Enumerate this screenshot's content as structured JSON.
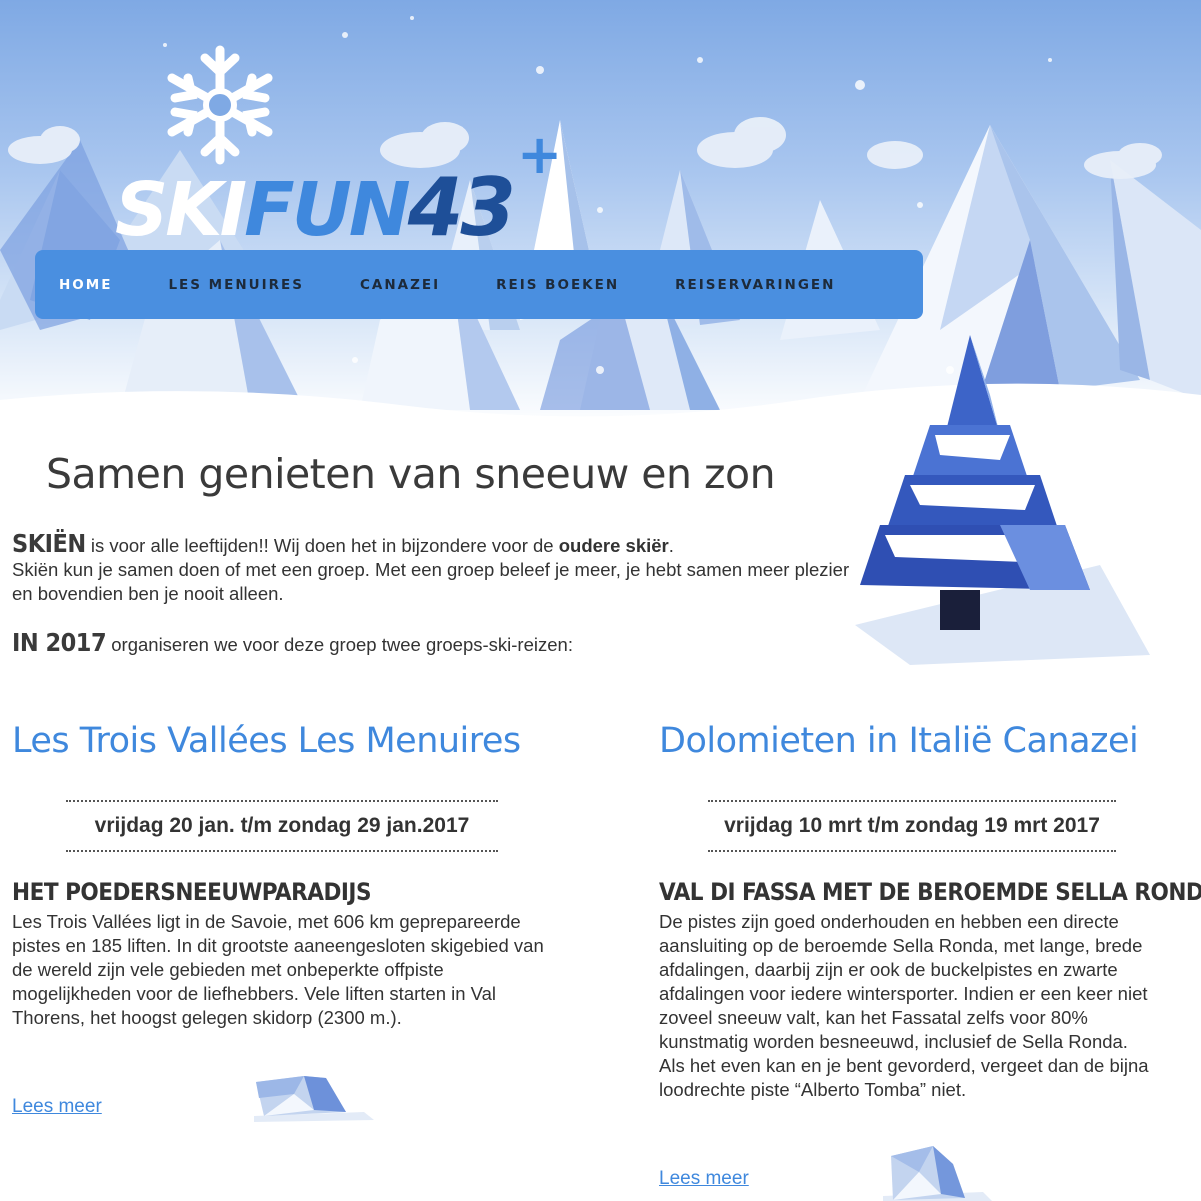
{
  "brand": {
    "logo_ski": "SKI",
    "logo_fun": "FUN",
    "logo_number": "43",
    "logo_plus": "+"
  },
  "nav": {
    "items": [
      {
        "label": "HOME",
        "active": true
      },
      {
        "label": "LES MENUIRES",
        "active": false
      },
      {
        "label": "CANAZEI",
        "active": false
      },
      {
        "label": "REIS BOEKEN",
        "active": false
      },
      {
        "label": "REISERVARINGEN",
        "active": false
      }
    ]
  },
  "intro": {
    "title": "Samen genieten van sneeuw en zon",
    "lead_word": "SKIËN",
    "lead_rest_1": " is voor alle leeftijden!! Wij doen het in bijzondere voor de ",
    "lead_bold": "oudere skiër",
    "lead_rest_2": ".",
    "paragraph": "Skiën kun je samen doen of met een groep. Met een groep beleef je meer, je hebt samen meer plezier en bovendien ben je nooit alleen.",
    "year_word": "IN 2017",
    "year_rest": " organiseren we voor deze groep twee groeps-ski-reizen:"
  },
  "trips": [
    {
      "title": "Les Trois Vallées Les Menuires",
      "dates": "vrijdag 20 jan. t/m zondag 29 jan.2017",
      "heading": "HET POEDERSNEEUWPARADIJS",
      "text": "Les Trois Vallées ligt in de Savoie, met 606 km geprepareerde pistes en 185 liften. In dit grootste aaneengesloten skigebied van de wereld zijn vele gebieden met onbeperkte offpiste mogelijkheden voor de liefhebbers. Vele liften starten in Val Thorens, het hoogst gelegen skidorp (2300 m.).",
      "link": "Lees meer"
    },
    {
      "title": "Dolomieten in Italië Canazei",
      "dates": "vrijdag 10 mrt t/m zondag 19 mrt 2017",
      "heading": "VAL DI FASSA MET DE BEROEMDE SELLA RONDE",
      "text": "De pistes zijn goed onderhouden en hebben een directe aansluiting op de beroemde Sella Ronda, met lange, brede afdalingen, daarbij zijn er ook de buckelpistes en zwarte afdalingen voor iedere wintersporter. Indien er een keer niet zoveel sneeuw valt, kan het Fassatal zelfs voor 80% kunstmatig worden besneeuwd, inclusief de Sella Ronda.",
      "text2": "Als het even kan en je bent gevorderd, vergeet dan de bijna loodrechte piste “Alberto Tomba” niet.",
      "link": "Lees meer"
    }
  ],
  "colors": {
    "accent": "#3f88dd",
    "nav_bg": "#4a8fe0",
    "logo_dark": "#1e4f98"
  },
  "icons": [
    "snowflake-logo-icon",
    "christmas-tree-illustration",
    "ice-block-icon"
  ]
}
